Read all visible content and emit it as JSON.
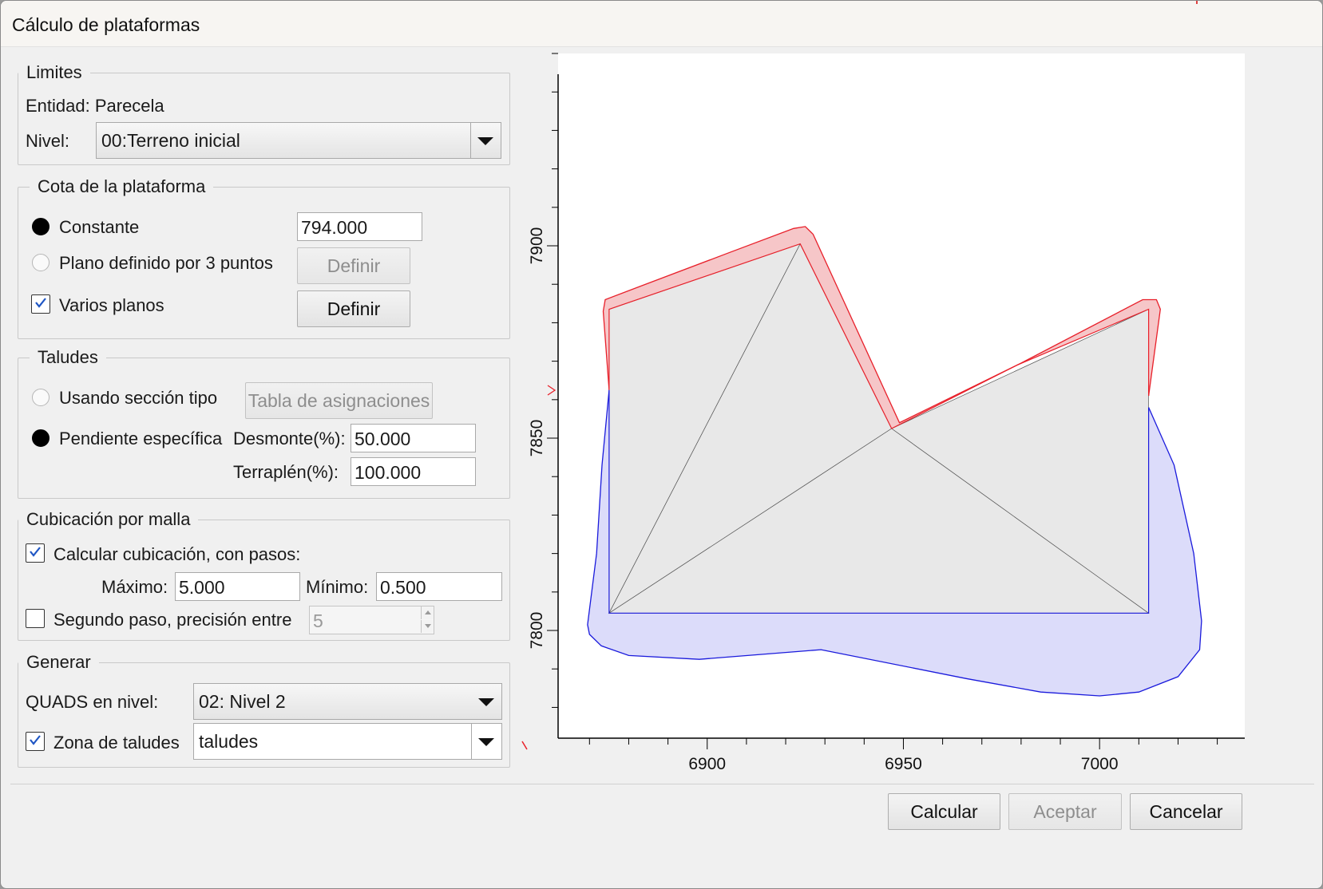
{
  "window": {
    "title": "Cálculo de plataformas"
  },
  "limites": {
    "legend": "Limites",
    "entidad": "Entidad: Parecela",
    "nivel_label": "Nivel:",
    "nivel_value": "00:Terreno inicial"
  },
  "cota": {
    "legend": "Cota de la plataforma",
    "constante_label": "Constante",
    "constante_value": "794.000",
    "constante_selected": true,
    "plano_label": "Plano definido por 3 puntos",
    "plano_selected": false,
    "plano_button": "Definir",
    "varios_label": "Varios planos",
    "varios_checked": true,
    "varios_button": "Definir"
  },
  "taludes": {
    "legend": "Taludes",
    "seccion_label": "Usando sección tipo",
    "seccion_selected": false,
    "tabla_button": "Tabla de asignaciones",
    "pendiente_label": "Pendiente específica",
    "pendiente_selected": true,
    "desmonte_label": "Desmonte(%):",
    "desmonte_value": "50.000",
    "terraplen_label": "Terraplén(%):",
    "terraplen_value": "100.000"
  },
  "cubicacion": {
    "legend": "Cubicación por malla",
    "calcular_label": "Calcular cubicación, con pasos:",
    "calcular_checked": true,
    "maximo_label": "Máximo:",
    "maximo_value": "5.000",
    "minimo_label": "Mínimo:",
    "minimo_value": "0.500",
    "segundo_label": "Segundo paso, precisión entre",
    "segundo_checked": false,
    "segundo_value": "5"
  },
  "generar": {
    "legend": "Generar",
    "quads_label": "QUADS en nivel:",
    "quads_value": "02: Nivel 2",
    "zona_label": "Zona de taludes",
    "zona_checked": true,
    "zona_value": "taludes"
  },
  "buttons": {
    "calcular": "Calcular",
    "aceptar": "Aceptar",
    "cancelar": "Cancelar"
  },
  "colors": {
    "cut_stroke": "#e8202a",
    "cut_fill": "#f6c6c8",
    "fill_stroke": "#1a1adc",
    "fill_fill": "#dcdcfa",
    "platform_fill": "#e8e8e8",
    "platform_stroke": "#555555"
  },
  "chart_data": {
    "type": "plan-view",
    "xlim": [
      6862,
      7037
    ],
    "ylim": [
      7772,
      7950
    ],
    "x_ticks": [
      6900,
      6950,
      7000
    ],
    "y_ticks": [
      7800,
      7850,
      7900
    ],
    "x_minor_step": 10,
    "y_minor_step": 10,
    "platform": {
      "vertices": [
        [
          6875,
          7804.5
        ],
        [
          6875,
          7883.5
        ],
        [
          6923.7,
          7900.5
        ],
        [
          6947,
          7852.5
        ],
        [
          6979,
          7869
        ],
        [
          7012.5,
          7883.5
        ],
        [
          7012.5,
          7804.5
        ]
      ],
      "triangles": [
        [
          [
            6875,
            7804.5
          ],
          [
            6875,
            7883.5
          ],
          [
            6923.7,
            7900.5
          ]
        ],
        [
          [
            6875,
            7804.5
          ],
          [
            6923.7,
            7900.5
          ],
          [
            6947,
            7852.5
          ]
        ],
        [
          [
            6875,
            7804.5
          ],
          [
            6947,
            7852.5
          ],
          [
            7012.5,
            7804.5
          ]
        ],
        [
          [
            6947,
            7852.5
          ],
          [
            7012.5,
            7883.5
          ],
          [
            7012.5,
            7804.5
          ]
        ]
      ]
    },
    "cut_zone": {
      "outer": [
        [
          6875,
          7862.5
        ],
        [
          6873.5,
          7883
        ],
        [
          6874,
          7886
        ],
        [
          6883,
          7889.5
        ],
        [
          6905,
          7898
        ],
        [
          6922,
          7904.5
        ],
        [
          6925,
          7905
        ],
        [
          6927,
          7903
        ],
        [
          6949,
          7854
        ],
        [
          6980,
          7869.5
        ],
        [
          7011,
          7886
        ],
        [
          7014.5,
          7886
        ],
        [
          7015.5,
          7883.5
        ],
        [
          7012.5,
          7861
        ]
      ],
      "inner": [
        [
          6875,
          7862.5
        ],
        [
          6875,
          7883.5
        ],
        [
          6923.7,
          7900.5
        ],
        [
          6947,
          7852.5
        ],
        [
          6979,
          7869
        ],
        [
          7012.5,
          7883.5
        ],
        [
          7012.5,
          7861
        ]
      ]
    },
    "fill_zone": {
      "outer": [
        [
          6875,
          7862.5
        ],
        [
          6873.2,
          7843
        ],
        [
          6871.8,
          7820
        ],
        [
          6869.5,
          7801.5
        ],
        [
          6870,
          7799
        ],
        [
          6873,
          7796
        ],
        [
          6880,
          7793.5
        ],
        [
          6898,
          7792.5
        ],
        [
          6929,
          7795
        ],
        [
          6966,
          7787.5
        ],
        [
          6985,
          7784
        ],
        [
          7000,
          7783
        ],
        [
          7010,
          7784
        ],
        [
          7020,
          7788
        ],
        [
          7025.5,
          7795
        ],
        [
          7026,
          7802.5
        ],
        [
          7024,
          7820
        ],
        [
          7019,
          7843
        ],
        [
          7012.5,
          7858
        ]
      ],
      "inner": [
        [
          6875,
          7862.5
        ],
        [
          6875,
          7804.5
        ],
        [
          7012.5,
          7804.5
        ],
        [
          7012.5,
          7858
        ]
      ]
    }
  }
}
